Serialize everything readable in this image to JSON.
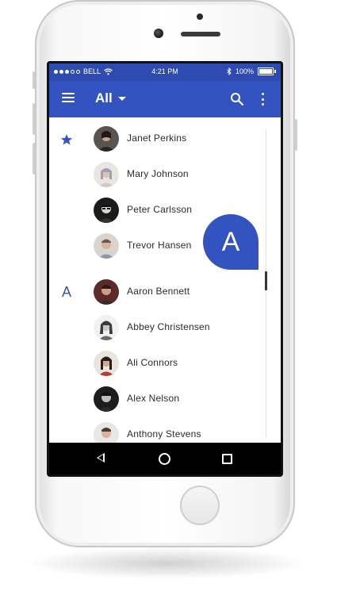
{
  "status_bar": {
    "carrier": "BELL",
    "time": "4:21 PM",
    "battery": "100%"
  },
  "app_bar": {
    "title": "All",
    "icons": [
      "menu-icon",
      "dropdown-caret-icon",
      "search-icon",
      "more-vert-icon"
    ]
  },
  "sections": [
    {
      "marker": "star-icon",
      "contacts": [
        {
          "name": "Janet Perkins"
        },
        {
          "name": "Mary Johnson"
        },
        {
          "name": "Peter Carlsson"
        },
        {
          "name": "Trevor Hansen"
        }
      ]
    },
    {
      "marker": "A",
      "contacts": [
        {
          "name": "Aaron Bennett"
        },
        {
          "name": "Abbey Christensen"
        },
        {
          "name": "Ali Connors"
        },
        {
          "name": "Alex Nelson"
        },
        {
          "name": "Anthony Stevens"
        }
      ]
    }
  ],
  "fast_scroll_letter": "A",
  "nav_bar": {
    "icons": [
      "back-icon",
      "home-icon",
      "recents-icon"
    ]
  },
  "colors": {
    "primary": "#3353c1",
    "status_bar": "#2d4bb0"
  }
}
